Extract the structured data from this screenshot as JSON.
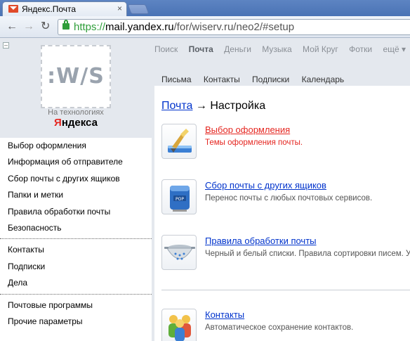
{
  "browser": {
    "tab_title": "Яндекс.Почта",
    "tab_close": "×",
    "url_scheme": "https://",
    "url_host": "mail.yandex.ru",
    "url_path": "/for/wiserv.ru/neo2/#setup",
    "back_icon": "←",
    "forward_icon": "→",
    "reload_icon": "↻"
  },
  "sidebar": {
    "collapse_label": "–",
    "partner_logo": ":W/S",
    "tech_caption": "На технологиях",
    "yandex_logo_first": "Я",
    "yandex_logo_rest": "ндекса",
    "groups": [
      {
        "items": [
          {
            "label": "Выбор оформления"
          },
          {
            "label": "Информация об отправителе"
          },
          {
            "label": "Сбор почты с других ящиков"
          },
          {
            "label": "Папки и метки"
          },
          {
            "label": "Правила обработки почты"
          },
          {
            "label": "Безопасность"
          }
        ]
      },
      {
        "items": [
          {
            "label": "Контакты"
          },
          {
            "label": "Подписки"
          },
          {
            "label": "Дела"
          }
        ]
      },
      {
        "items": [
          {
            "label": "Почтовые программы"
          },
          {
            "label": "Прочие параметры"
          }
        ]
      }
    ]
  },
  "services": {
    "items": [
      {
        "label": "Поиск"
      },
      {
        "label": "Почта"
      },
      {
        "label": "Деньги"
      },
      {
        "label": "Музыка"
      },
      {
        "label": "Мой Круг"
      },
      {
        "label": "Фотки"
      },
      {
        "label": "ещё ▾"
      }
    ],
    "active": "Почта"
  },
  "subnav": {
    "items": [
      {
        "label": "Письма"
      },
      {
        "label": "Контакты"
      },
      {
        "label": "Подписки"
      },
      {
        "label": "Календарь"
      }
    ]
  },
  "breadcrumb": {
    "link": "Почта",
    "arrow": " → ",
    "current": "Настройка"
  },
  "settings": [
    {
      "title": "Выбор оформления",
      "desc": "Темы оформления почты.",
      "icon": "paint-brush-icon",
      "selected": true
    },
    {
      "title": "Сбор почты с других ящиков",
      "desc": "Перенос почты с любых почтовых сервисов.",
      "icon": "mailbox-icon",
      "selected": false
    },
    {
      "title": "Правила обработки почты",
      "desc": "Черный и белый списки. Правила сортировки писем. У",
      "icon": "colander-icon",
      "selected": false
    },
    {
      "title": "Контакты",
      "desc": "Автоматическое сохранение контактов.",
      "icon": "contacts-people-icon",
      "selected": false
    }
  ],
  "colors": {
    "link": "#0033cc",
    "selected": "#e52620",
    "chrome_blue": "#4a73b5",
    "sidebar_bg": "#e4e8ee"
  }
}
